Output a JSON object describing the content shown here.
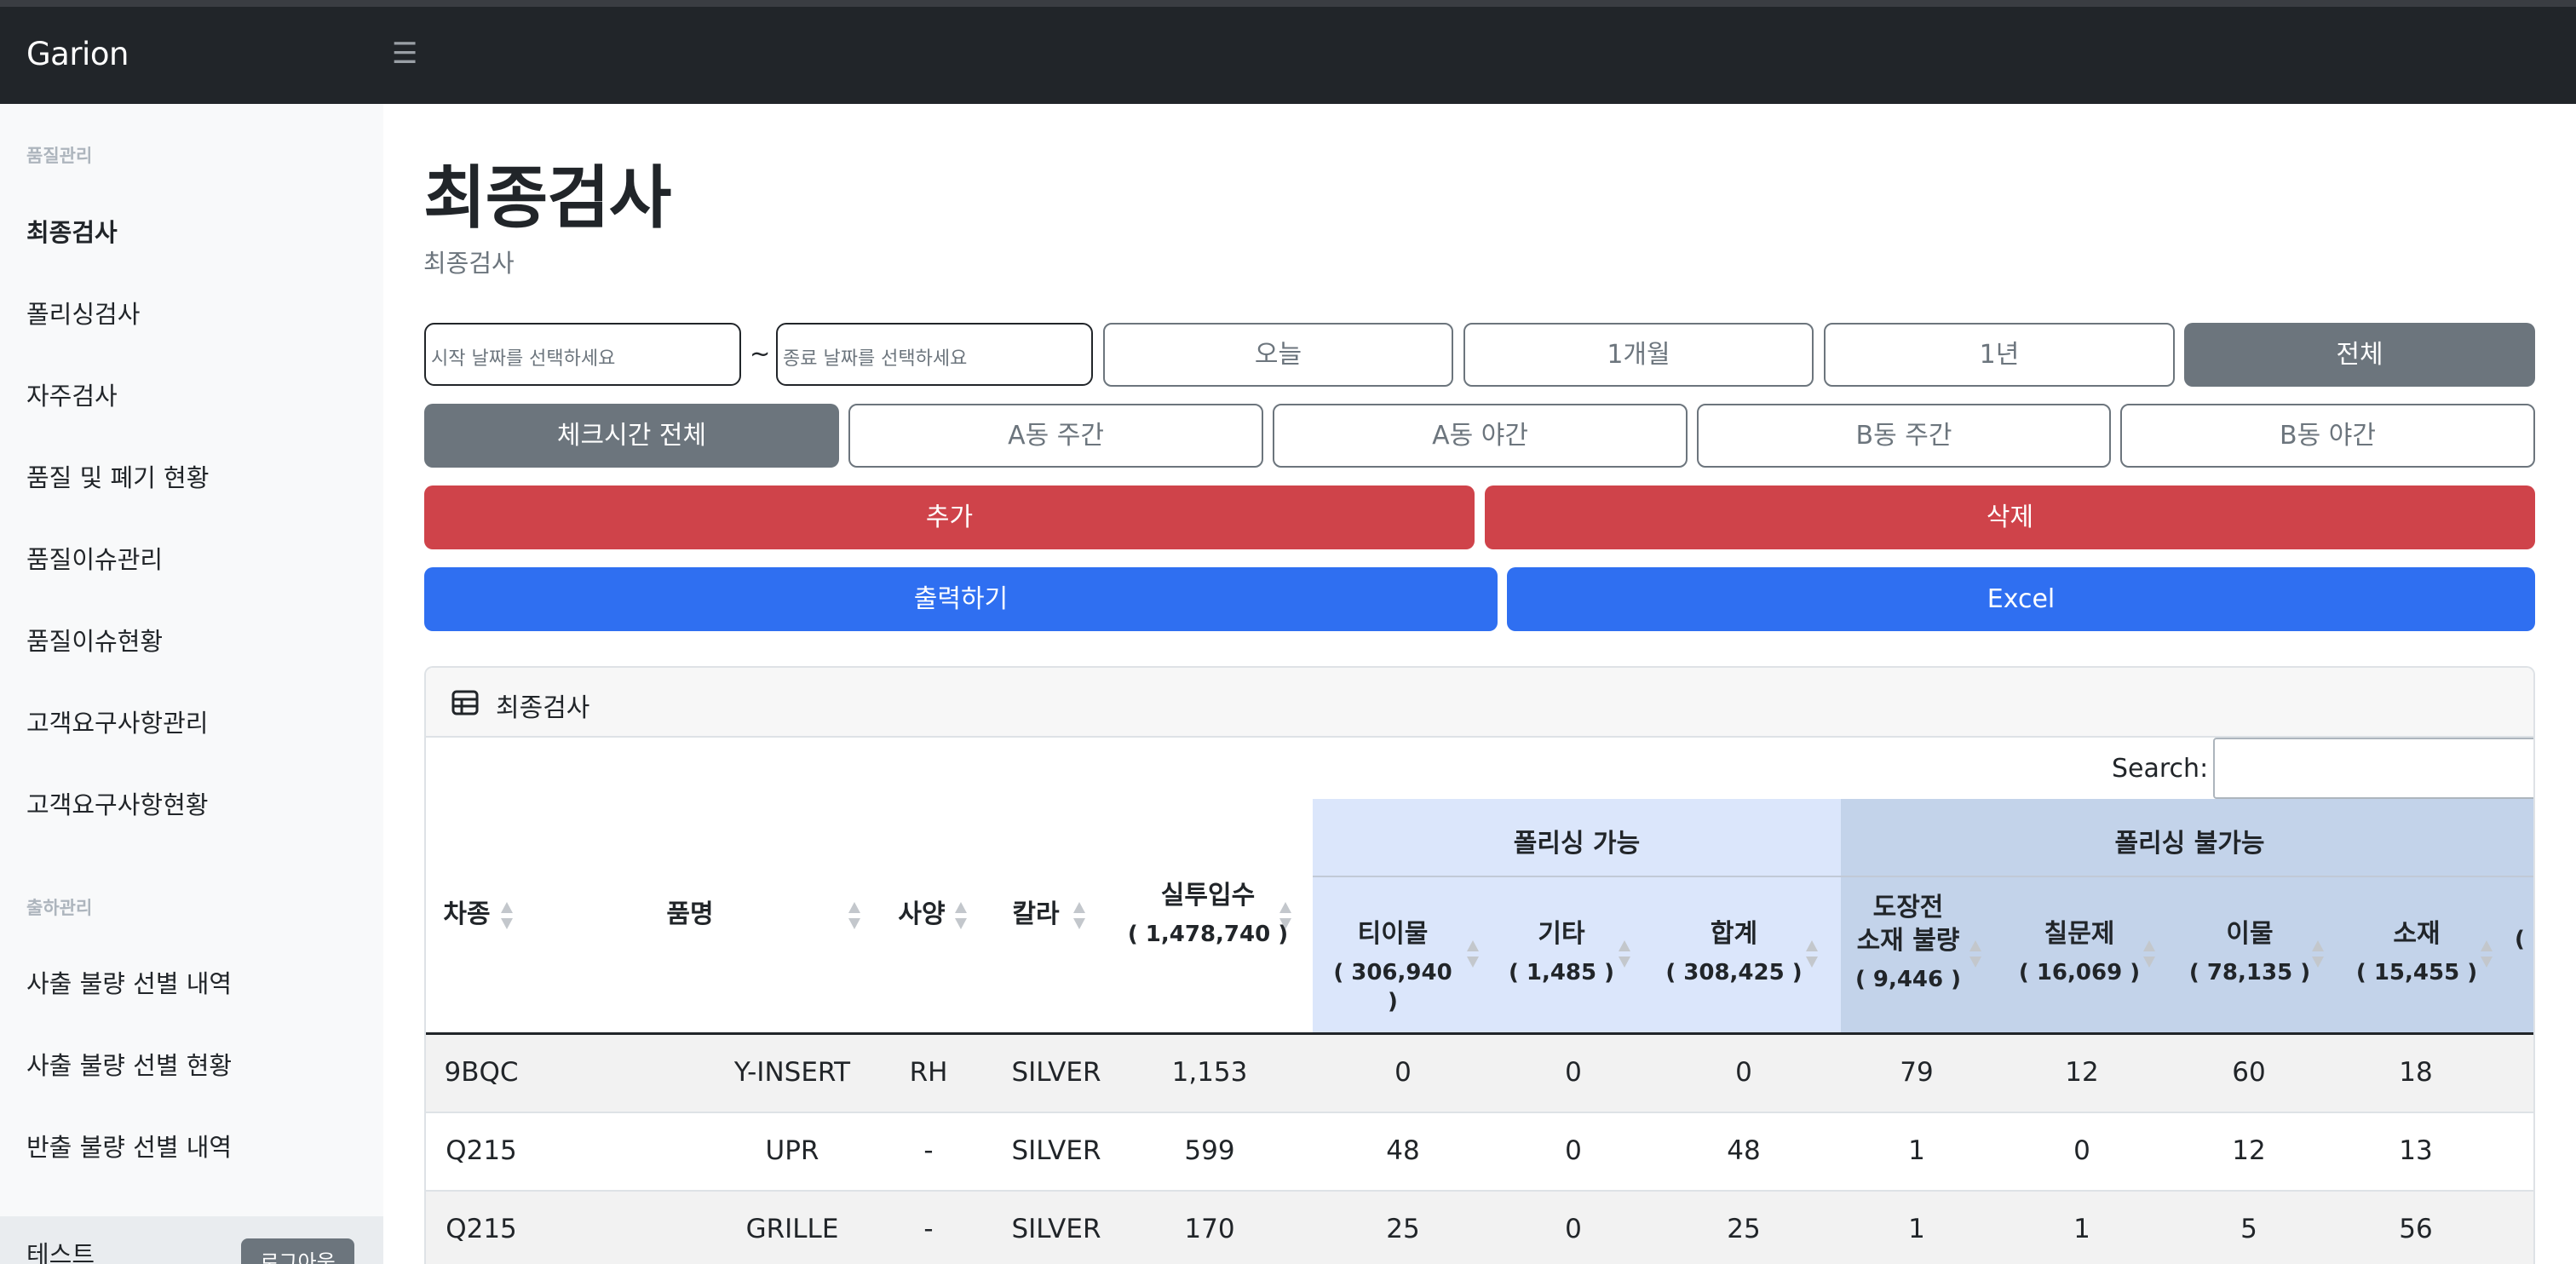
{
  "app": {
    "brand": "Garion",
    "menu_icon": "hamburger-icon"
  },
  "sidebar": {
    "sections": [
      {
        "heading": "품질관리",
        "items": [
          "최종검사",
          "폴리싱검사",
          "자주검사",
          "품질 및 폐기 현황",
          "품질이슈관리",
          "품질이슈현황",
          "고객요구사항관리",
          "고객요구사항현황"
        ]
      },
      {
        "heading": "출하관리",
        "items": [
          "사출 불량 선별 내역",
          "사출 불량 선별 현황",
          "반출 불량 선별 내역"
        ]
      }
    ],
    "active_item": "최종검사",
    "footer": {
      "user": "테스트",
      "logout": "로그아웃"
    }
  },
  "page": {
    "title": "최종검사",
    "subtitle": "최종검사"
  },
  "filters": {
    "start_placeholder": "시작 날짜를 선택하세요",
    "separator": "~",
    "end_placeholder": "종료 날짜를 선택하세요",
    "period_buttons": [
      "오늘",
      "1개월",
      "1년",
      "전체"
    ],
    "period_selected": "전체",
    "shift_buttons": [
      "체크시간 전체",
      "A동 주간",
      "A동 야간",
      "B동 주간",
      "B동 야간"
    ],
    "shift_selected": "체크시간 전체"
  },
  "actions": {
    "add": "추가",
    "delete": "삭제",
    "print": "출력하기",
    "excel": "Excel"
  },
  "card": {
    "title": "최종검사",
    "icon": "table-icon",
    "search_label": "Search:"
  },
  "table": {
    "group_polishable": "폴리싱 가능",
    "group_not_polishable": "폴리싱 불가능",
    "columns": [
      {
        "label": "차종"
      },
      {
        "label": "품명"
      },
      {
        "label": "사양"
      },
      {
        "label": "칼라"
      },
      {
        "label": "실투입수",
        "count": "( 1,478,740 )"
      },
      {
        "label": "티이물",
        "count": "( 306,940 )"
      },
      {
        "label": "기타",
        "count": "( 1,485 )"
      },
      {
        "label": "합계",
        "count": "( 308,425 )"
      },
      {
        "label": "도장전",
        "label2": "소재 불량",
        "count": "( 9,446 )"
      },
      {
        "label": "칠문제",
        "count": "( 16,069 )"
      },
      {
        "label": "이물",
        "count": "( 78,135 )"
      },
      {
        "label": "소재",
        "count": "( 15,455 )"
      },
      {
        "label": "",
        "count": "("
      }
    ],
    "rows": [
      [
        "9BQC",
        "Y-INSERT",
        "RH",
        "SILVER",
        "1,153",
        "0",
        "0",
        "0",
        "79",
        "12",
        "60",
        "18"
      ],
      [
        "Q215",
        "UPR",
        "-",
        "SILVER",
        "599",
        "48",
        "0",
        "48",
        "1",
        "0",
        "12",
        "13"
      ],
      [
        "Q215",
        "GRILLE",
        "-",
        "SILVER",
        "170",
        "25",
        "0",
        "25",
        "1",
        "1",
        "5",
        "56"
      ]
    ]
  }
}
